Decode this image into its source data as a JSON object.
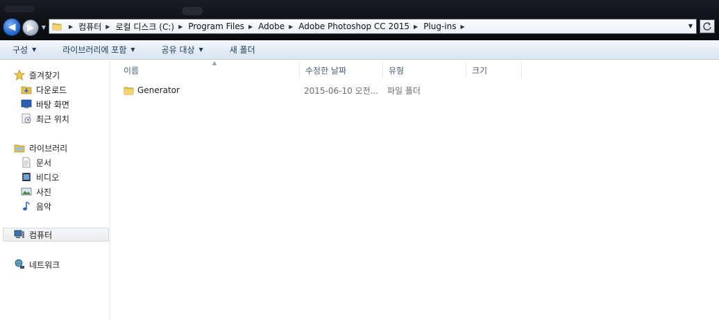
{
  "window": {
    "address_crumbs": [
      "컴퓨터",
      "로컬 디스크 (C:)",
      "Program Files",
      "Adobe",
      "Adobe Photoshop CC 2015",
      "Plug-ins"
    ]
  },
  "toolbar": {
    "organize_label": "구성",
    "include_library_label": "라이브러리에 포함",
    "share_label": "공유 대상",
    "new_folder_label": "새 폴더"
  },
  "navpane": {
    "favorites": {
      "label": "즐겨찾기",
      "items": [
        "다운로드",
        "바탕 화면",
        "최근 위치"
      ]
    },
    "libraries": {
      "label": "라이브러리",
      "items": [
        "문서",
        "비디오",
        "사진",
        "음악"
      ]
    },
    "computer": {
      "label": "컴퓨터"
    },
    "network": {
      "label": "네트워크"
    }
  },
  "filelist": {
    "columns": [
      "이름",
      "수정한 날짜",
      "유형",
      "크기"
    ],
    "rows": [
      {
        "name": "Generator",
        "modified": "2015-06-10 오전...",
        "type": "파일 폴더",
        "size": ""
      }
    ]
  },
  "colors": {
    "command_text": "#1e395b",
    "header_text": "#4c607a",
    "folder_yellow": "#e8c04a"
  },
  "icons": {
    "back": "arrow-left-icon",
    "forward": "arrow-right-icon",
    "refresh": "refresh-icon",
    "folder": "folder-icon",
    "star": "star-icon"
  }
}
